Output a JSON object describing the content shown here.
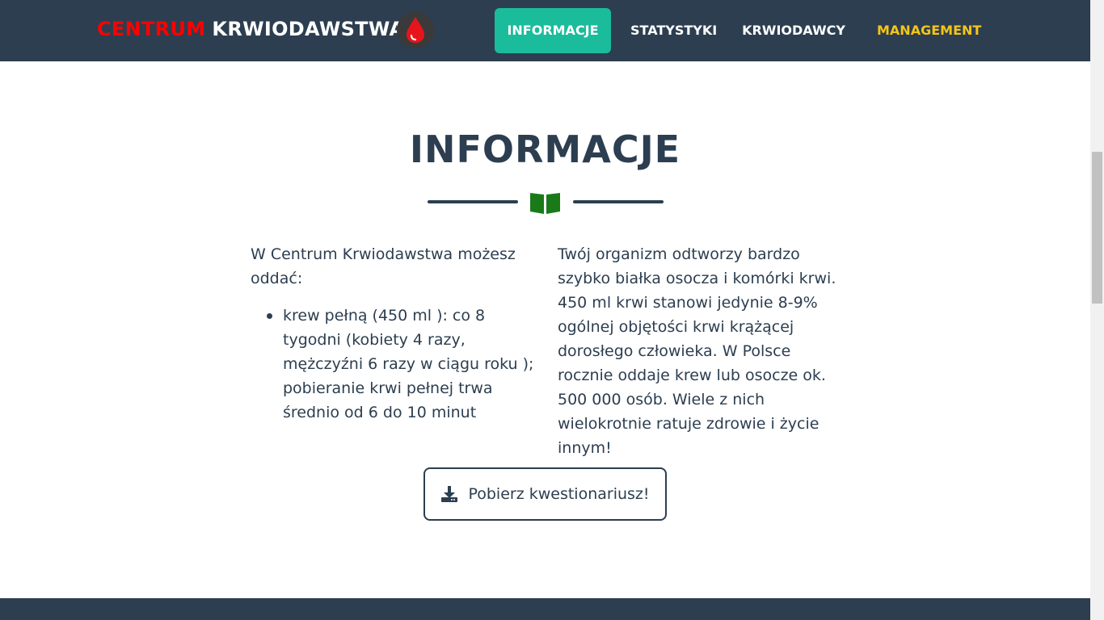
{
  "navbar": {
    "brand_red": "CENTRUM",
    "brand_white": "KRWIODAWSTWA",
    "items": [
      {
        "label": "INFORMACJE",
        "active": true
      },
      {
        "label": "STATYSTYKI"
      },
      {
        "label": "KRWIODAWCY"
      },
      {
        "label": "MANAGEMENT",
        "color": "#f5c518"
      }
    ]
  },
  "section": {
    "title": "INFORMACJE",
    "left_intro": "W Centrum Krwiodawstwa możesz oddać:",
    "left_list": [
      "krew pełną (450 ml ): co 8 tygodni (kobiety 4 razy, mężczyźni 6 razy w ciągu roku ); pobieranie krwi pełnej trwa średnio od 6 do 10 minut"
    ],
    "right_text": "Twój organizm odtworzy bardzo szybko białka osocza i komórki krwi. 450 ml krwi stanowi jedynie 8-9% ogólnej objętości krwi krążącej dorosłego człowieka. W Polsce rocznie oddaje krew lub osocze ok. 500 000 osób. Wiele z nich wielokrotnie ratuje zdrowie i życie innym!",
    "download_label": "Pobierz kwestionariusz!"
  },
  "colors": {
    "navbar_bg": "#2c3e50",
    "active_bg": "#1abc9c",
    "brand_red": "#ff0000",
    "management": "#f5c518",
    "book_icon": "#1a7a1a"
  },
  "icons": {
    "logo": "blood-drop-icon",
    "divider": "book-open-icon",
    "download": "download-icon"
  }
}
